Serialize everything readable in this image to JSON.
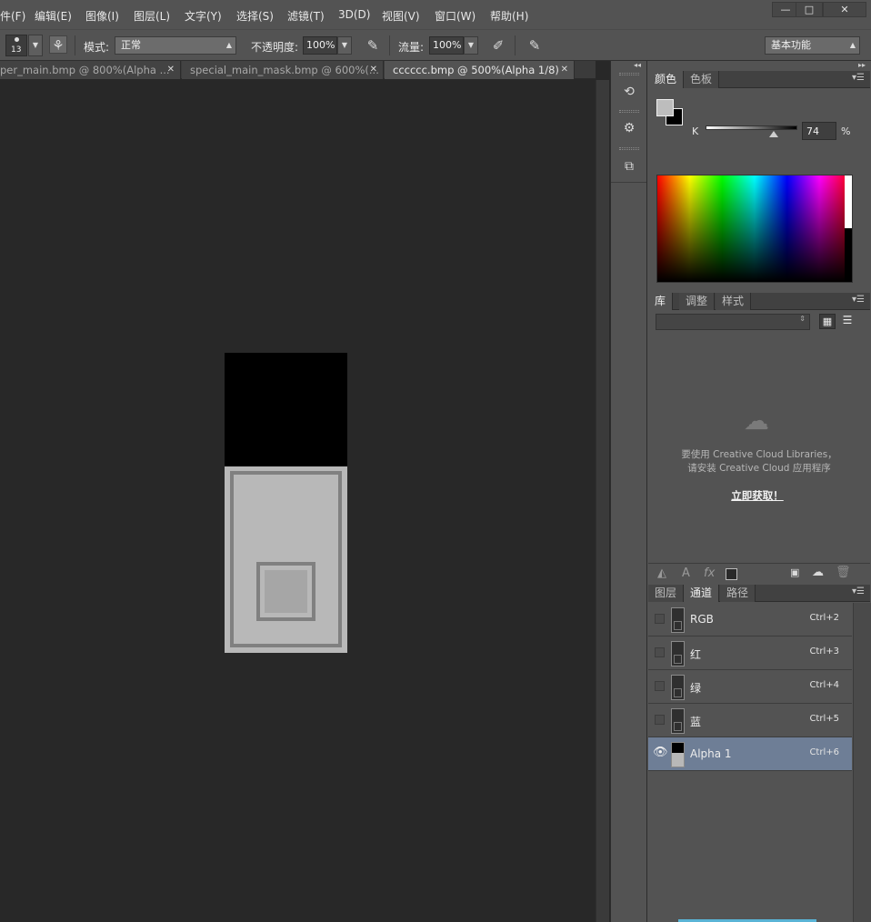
{
  "menubar": {
    "items": [
      "件(F)",
      "编辑(E)",
      "图像(I)",
      "图层(L)",
      "文字(Y)",
      "选择(S)",
      "滤镜(T)",
      "3D(D)",
      "视图(V)",
      "窗口(W)",
      "帮助(H)"
    ],
    "window_controls": [
      "—",
      "□",
      "✕"
    ]
  },
  "options": {
    "brush_size": "13",
    "mode_label": "模式:",
    "mode_value": "正常",
    "opacity_label": "不透明度:",
    "opacity_value": "100%",
    "flow_label": "流量:",
    "flow_value": "100%",
    "workspace": "基本功能"
  },
  "tabs": [
    {
      "label": "per_main.bmp @ 800%(Alpha ...",
      "active": false
    },
    {
      "label": "special_main_mask.bmp @ 600%(...",
      "active": false
    },
    {
      "label": "cccccc.bmp @ 500%(Alpha 1/8)",
      "active": true
    }
  ],
  "color_panel": {
    "tabs": [
      "颜色",
      "色板"
    ],
    "channel_label": "K",
    "k_value": "74",
    "unit": "%",
    "k_level": 0.74
  },
  "library_panel": {
    "tabs": [
      "库",
      "调整",
      "样式"
    ],
    "message_line1": "要使用 Creative Cloud Libraries，",
    "message_line2": "请安装 Creative Cloud 应用程序",
    "link": "立即获取！"
  },
  "channels_panel": {
    "tabs": [
      "图层",
      "通道",
      "路径"
    ],
    "rows": [
      {
        "name": "RGB",
        "shortcut": "Ctrl+2",
        "visible": false,
        "selected": false
      },
      {
        "name": "红",
        "shortcut": "Ctrl+3",
        "visible": false,
        "selected": false
      },
      {
        "name": "绿",
        "shortcut": "Ctrl+4",
        "visible": false,
        "selected": false
      },
      {
        "name": "蓝",
        "shortcut": "Ctrl+5",
        "visible": false,
        "selected": false
      },
      {
        "name": "Alpha 1",
        "shortcut": "Ctrl+6",
        "visible": true,
        "selected": true
      }
    ]
  },
  "colors": {
    "ui_bg": "#535353",
    "canvas_bg": "#282828",
    "selection": "#6e7e96",
    "doc_black": "#000000",
    "doc_light": "#b8b8b8",
    "doc_border": "#808080"
  }
}
